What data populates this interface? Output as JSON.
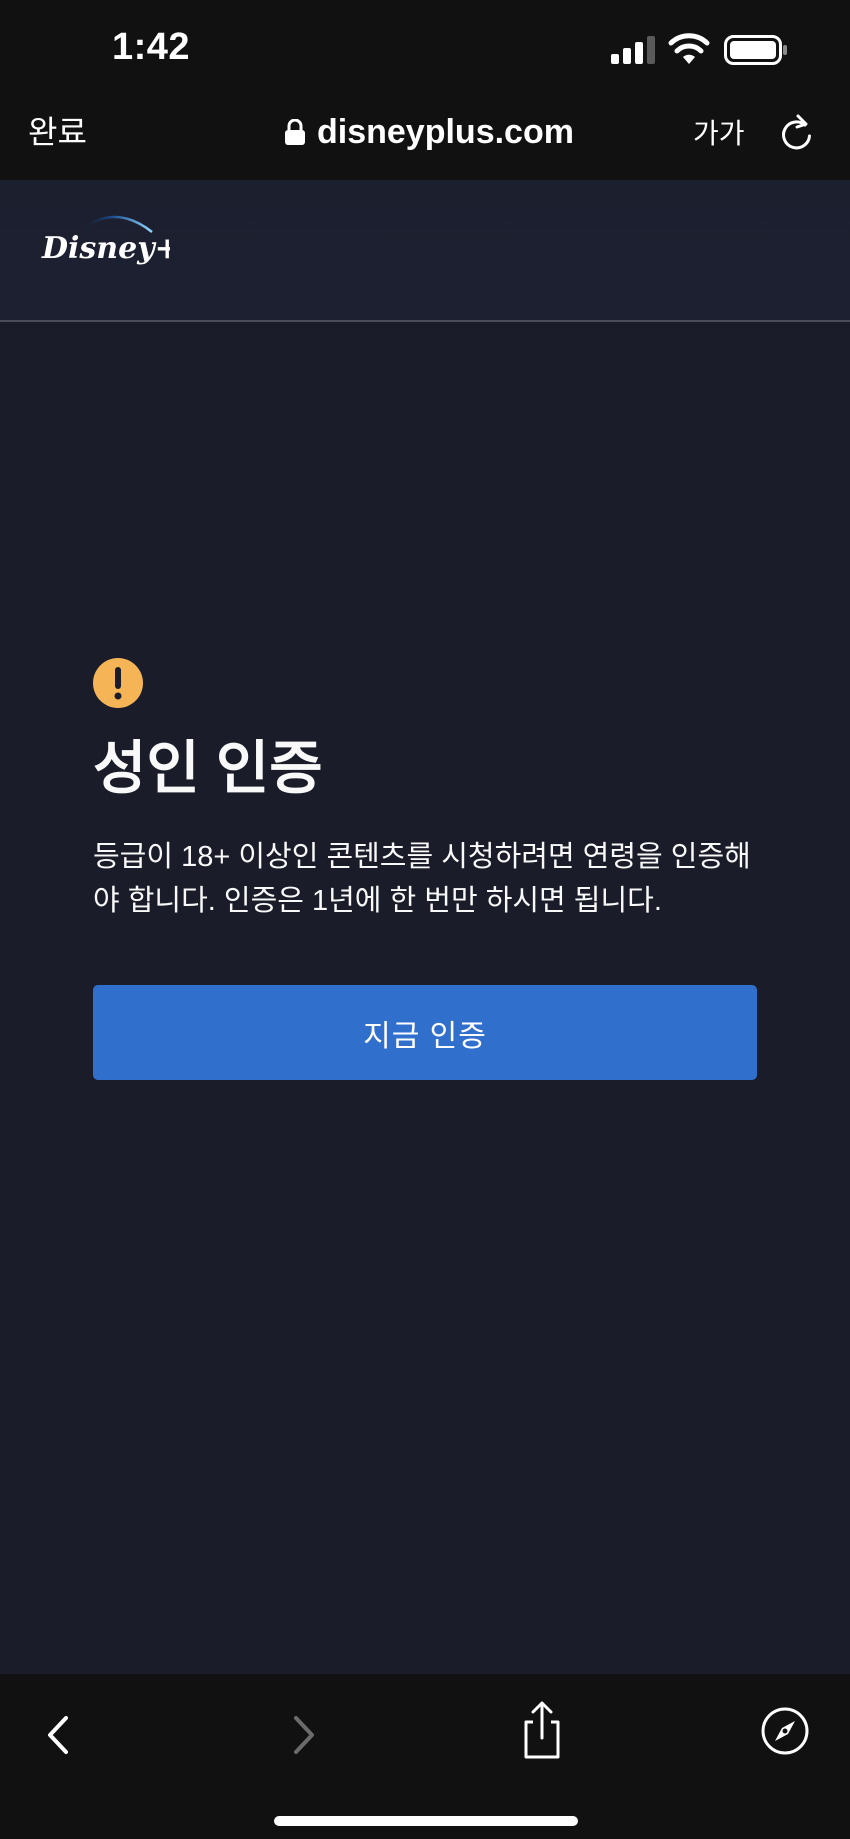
{
  "status_bar": {
    "time": "1:42",
    "icons": [
      "signal-icon",
      "wifi-icon",
      "battery-icon"
    ]
  },
  "browser": {
    "done_label": "완료",
    "url": "disneyplus.com",
    "text_size_label": "가가",
    "icons": [
      "lock-icon",
      "reload-icon"
    ]
  },
  "header": {
    "logo_text": "Disney+"
  },
  "main": {
    "title": "성인 인증",
    "description": "등급이 18+ 이상인 콘텐츠를 시청하려면 연령을 인증해야 합니다. 인증은 1년에 한 번만 하시면 됩니다.",
    "verify_button_label": "지금 인증",
    "icon": "warning-icon"
  },
  "toolbar": {
    "icons": [
      "back-icon",
      "forward-icon",
      "share-icon",
      "compass-icon"
    ]
  },
  "colors": {
    "page_background": "#1a1d29",
    "browser_chrome": "#111111",
    "accent_button": "#3070cc",
    "warning": "#f5b556",
    "text": "#f9f9f9"
  }
}
